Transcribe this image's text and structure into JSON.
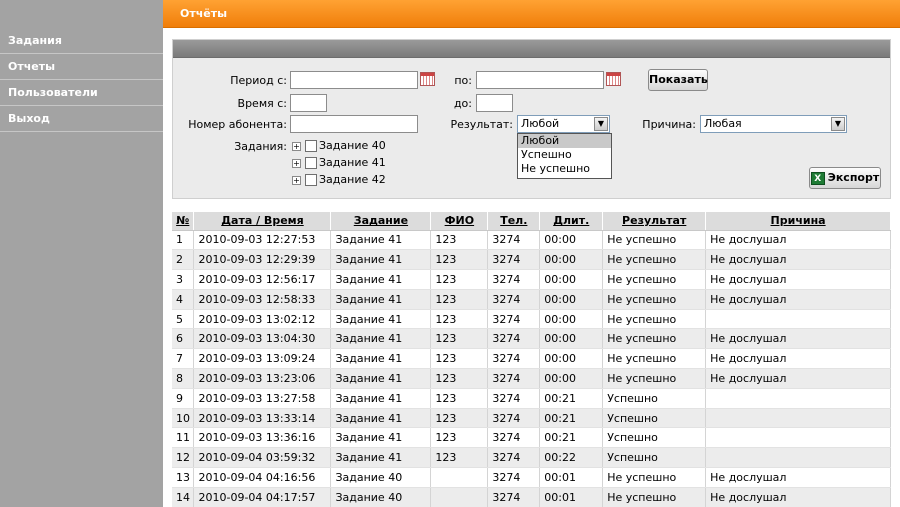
{
  "sidebar": {
    "items": [
      {
        "label": "Задания"
      },
      {
        "label": "Отчеты"
      },
      {
        "label": "Пользователи"
      },
      {
        "label": "Выход"
      }
    ]
  },
  "header": {
    "title": "Отчёты"
  },
  "filters": {
    "period_from_label": "Период с:",
    "period_from_value": "",
    "period_to_label": "по:",
    "period_to_value": "",
    "time_from_label": "Время с:",
    "time_from_value": "",
    "time_to_label": "до:",
    "time_to_value": "",
    "subscriber_label": "Номер абонента:",
    "subscriber_value": "",
    "result_label": "Результат:",
    "result_value": "Любой",
    "result_options": [
      "Любой",
      "Успешно",
      "Не успешно"
    ],
    "reason_label": "Причина:",
    "reason_value": "Любая",
    "tasks_label": "Задания:",
    "tasks": [
      {
        "label": "Задание 40",
        "checked": false
      },
      {
        "label": "Задание 41",
        "checked": false
      },
      {
        "label": "Задание 42",
        "checked": false
      }
    ],
    "show_button": "Показать",
    "export_button": "Экспорт"
  },
  "table": {
    "columns": [
      "№",
      "Дата / Время",
      "Задание",
      "ФИО",
      "Тел.",
      "Длит.",
      "Результат",
      "Причина"
    ],
    "rows": [
      [
        "1",
        "2010-09-03 12:27:53",
        "Задание 41",
        "123",
        "3274",
        "00:00",
        "Не успешно",
        "Не дослушал"
      ],
      [
        "2",
        "2010-09-03 12:29:39",
        "Задание 41",
        "123",
        "3274",
        "00:00",
        "Не успешно",
        "Не дослушал"
      ],
      [
        "3",
        "2010-09-03 12:56:17",
        "Задание 41",
        "123",
        "3274",
        "00:00",
        "Не успешно",
        "Не дослушал"
      ],
      [
        "4",
        "2010-09-03 12:58:33",
        "Задание 41",
        "123",
        "3274",
        "00:00",
        "Не успешно",
        "Не дослушал"
      ],
      [
        "5",
        "2010-09-03 13:02:12",
        "Задание 41",
        "123",
        "3274",
        "00:00",
        "Не успешно",
        ""
      ],
      [
        "6",
        "2010-09-03 13:04:30",
        "Задание 41",
        "123",
        "3274",
        "00:00",
        "Не успешно",
        "Не дослушал"
      ],
      [
        "7",
        "2010-09-03 13:09:24",
        "Задание 41",
        "123",
        "3274",
        "00:00",
        "Не успешно",
        "Не дослушал"
      ],
      [
        "8",
        "2010-09-03 13:23:06",
        "Задание 41",
        "123",
        "3274",
        "00:00",
        "Не успешно",
        "Не дослушал"
      ],
      [
        "9",
        "2010-09-03 13:27:58",
        "Задание 41",
        "123",
        "3274",
        "00:21",
        "Успешно",
        ""
      ],
      [
        "10",
        "2010-09-03 13:33:14",
        "Задание 41",
        "123",
        "3274",
        "00:21",
        "Успешно",
        ""
      ],
      [
        "11",
        "2010-09-03 13:36:16",
        "Задание 41",
        "123",
        "3274",
        "00:21",
        "Успешно",
        ""
      ],
      [
        "12",
        "2010-09-04 03:59:32",
        "Задание 41",
        "123",
        "3274",
        "00:22",
        "Успешно",
        ""
      ],
      [
        "13",
        "2010-09-04 04:16:56",
        "Задание 40",
        "",
        "3274",
        "00:01",
        "Не успешно",
        "Не дослушал"
      ],
      [
        "14",
        "2010-09-04 04:17:57",
        "Задание 40",
        "",
        "3274",
        "00:01",
        "Не успешно",
        "Не дослушал"
      ]
    ]
  },
  "colors": {
    "accent": "#f58a1f",
    "sidebar": "#a3a3a3",
    "panel_head": "#8a8a8a"
  }
}
